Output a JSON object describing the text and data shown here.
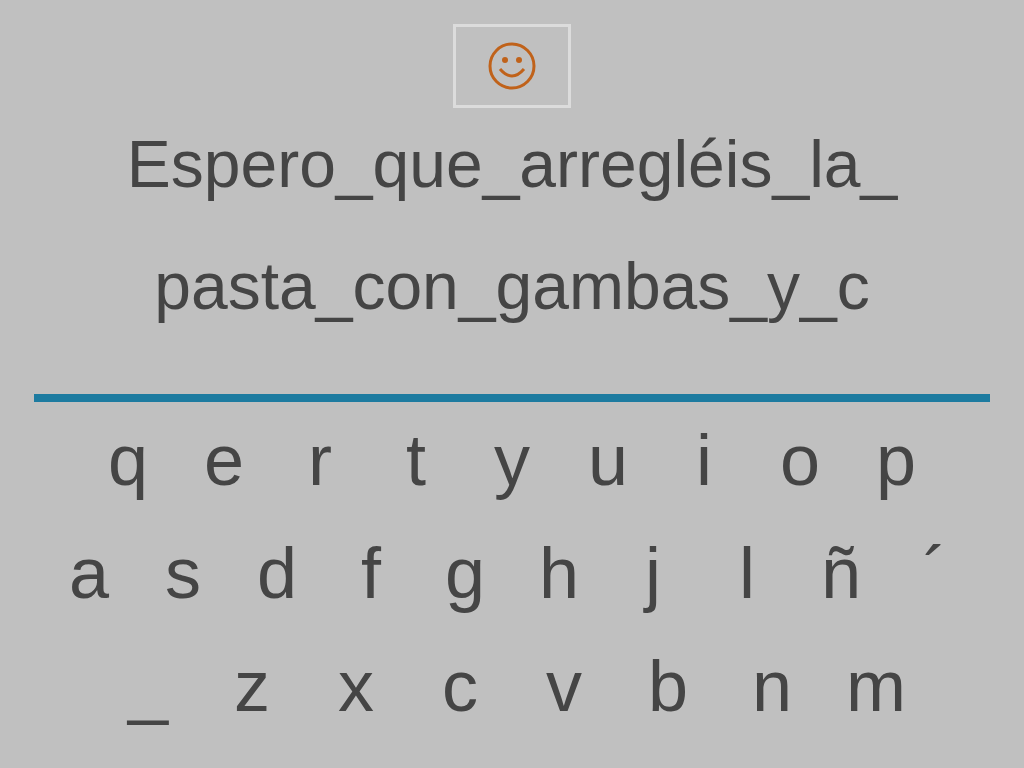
{
  "lines": [
    "Espero_que_arregléis_la_",
    "pasta_con_gambas_y_c"
  ],
  "keyboard": [
    [
      "q",
      "e",
      "r",
      "t",
      "y",
      "u",
      "i",
      "o",
      "p"
    ],
    [
      "a",
      "s",
      "d",
      "f",
      "g",
      "h",
      "j",
      "l",
      "ñ",
      "´"
    ],
    [
      "_",
      "z",
      "x",
      "c",
      "v",
      "b",
      "n",
      "m"
    ]
  ]
}
